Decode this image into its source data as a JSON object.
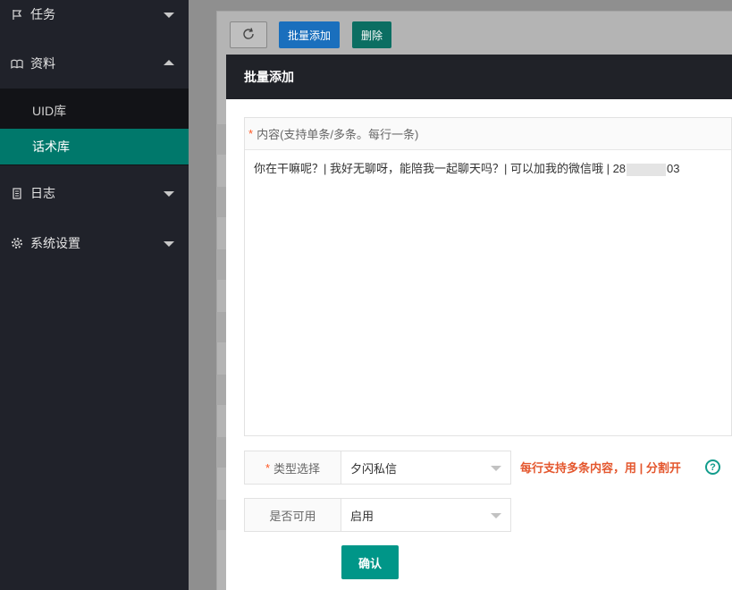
{
  "sidebar": {
    "items": [
      {
        "label": "任务",
        "icon": "flag-icon"
      },
      {
        "label": "资料",
        "icon": "book-icon"
      },
      {
        "label": "日志",
        "icon": "document-icon"
      },
      {
        "label": "系统设置",
        "icon": "gear-icon"
      }
    ],
    "sub_items": [
      {
        "label": "UID库"
      },
      {
        "label": "话术库",
        "active": true
      }
    ],
    "accent_color": "#00786b"
  },
  "toolbar": {
    "refresh_icon": "refresh-icon",
    "batch_add_label": "批量添加",
    "delete_label": "删除"
  },
  "modal": {
    "title": "批量添加",
    "content_label": "内容(支持单条/多条。每行一条)",
    "content_required": "*",
    "content_value_start": "你在干嘛呢？| 我好无聊呀，能陪我一起聊天吗？| 可以加我的微信哦 | 28",
    "content_value_end": "03",
    "type_label": "类型选择",
    "type_required": "*",
    "type_value": "夕闪私信",
    "hint": "每行支持多条内容，用 | 分割开",
    "help_icon": "?",
    "enabled_label": "是否可用",
    "enabled_value": "启用",
    "confirm_label": "确认"
  }
}
